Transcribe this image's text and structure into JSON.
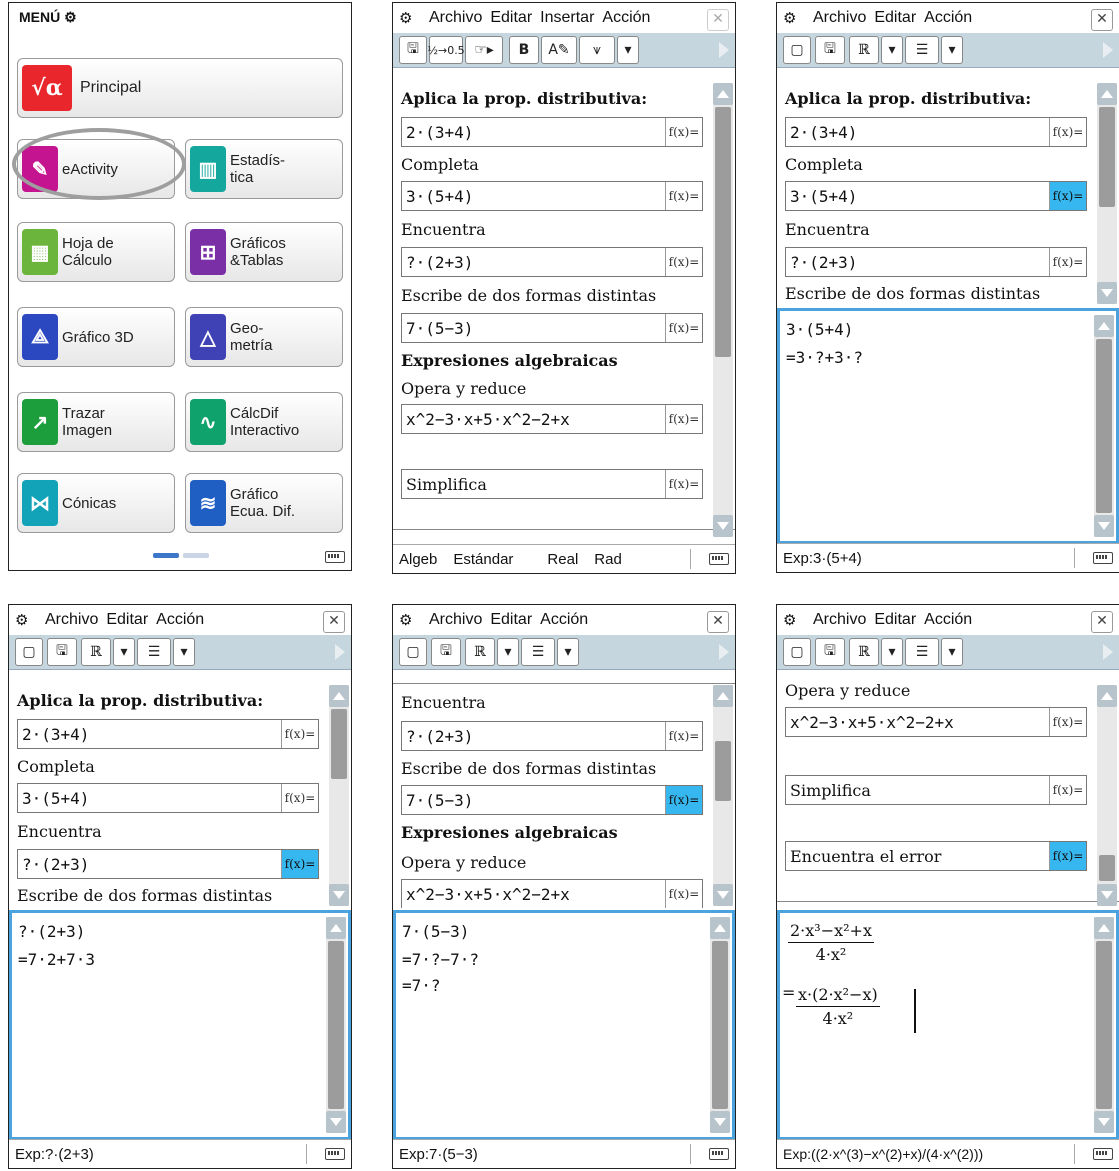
{
  "menu": {
    "header": "MENÚ",
    "items": [
      {
        "label": "Principal",
        "icon": "sqrt-alpha-icon",
        "color": "#e8262b",
        "glyph": "√α"
      },
      {
        "label": "eActivity",
        "icon": "eactivity-icon",
        "color": "#c4148f",
        "glyph": "✎"
      },
      {
        "label": "Estadís-\ntica",
        "icon": "statistics-icon",
        "color": "#14a79e",
        "glyph": "▥"
      },
      {
        "label": "Hoja de\nCálculo",
        "icon": "spreadsheet-icon",
        "color": "#6cb53c",
        "glyph": "▦"
      },
      {
        "label": "Gráficos\n&Tablas",
        "icon": "graph-table-icon",
        "color": "#7b2fa6",
        "glyph": "⊞"
      },
      {
        "label": "Gráfico 3D",
        "icon": "graph-3d-icon",
        "color": "#2c48c0",
        "glyph": "⟁"
      },
      {
        "label": "Geo-\nmetría",
        "icon": "geometry-icon",
        "color": "#3f42b4",
        "glyph": "△"
      },
      {
        "label": "Trazar\nImagen",
        "icon": "picture-plot-icon",
        "color": "#1b9e3b",
        "glyph": "↗"
      },
      {
        "label": "CálcDif\nInteractivo",
        "icon": "diffcalc-icon",
        "color": "#10a26c",
        "glyph": "∿"
      },
      {
        "label": "Cónicas",
        "icon": "conics-icon",
        "color": "#12a3b9",
        "glyph": "⋈"
      },
      {
        "label": "Gráfico\nEcua. Dif.",
        "icon": "diffeq-graph-icon",
        "color": "#1f5fc3",
        "glyph": "≋"
      }
    ]
  },
  "menubar_full": [
    "Archivo",
    "Editar",
    "Insertar",
    "Acción"
  ],
  "menubar_short": [
    "Archivo",
    "Editar",
    "Acción"
  ],
  "toolbar2": {
    "frac": "½→0.5",
    "hand": "☞▸",
    "bold": "B",
    "edit": "A✎",
    "graph": "⩛",
    "drop": "▾"
  },
  "toolbar3": {
    "new": "▢",
    "save": "🖫",
    "real": "ℝ",
    "drop": "▾",
    "list": "☰",
    "drop2": "▾"
  },
  "fx": "f(x)=",
  "ea": {
    "t1": "Aplica la prop. distributiva:",
    "e1": "2·(3+4)",
    "t2": "Completa",
    "e2": "3·(5+4)",
    "t3": "Encuentra",
    "e3": "?·(2+3)",
    "t4": "Escribe de dos formas distintas",
    "e4": "7·(5−3)",
    "t5": "Expresiones algebraicas",
    "t6": "Opera y reduce",
    "e6": "x^2−3·x+5·x^2−2+x",
    "e7": "Simplifica",
    "e8": "Encuentra el error"
  },
  "calc3": {
    "l1": "3·(5+4)",
    "l2": "=3·?+3·?"
  },
  "calc4": {
    "l1": "?·(2+3)",
    "l2": "=7·2+7·3"
  },
  "calc5": {
    "l1": "7·(5−3)",
    "l2": "=7·?−7·?",
    "l3": "=7·?"
  },
  "calc6": {
    "n1": "2·x³−x²+x",
    "d1": "4·x²",
    "eq": "=",
    "n2": "x·(2·x²−x)",
    "d2": "4·x²"
  },
  "status2": [
    "Algeb",
    "Estándar",
    "Real",
    "Rad"
  ],
  "status3": "Exp:3·(5+4)",
  "status4": "Exp:?·(2+3)",
  "status5": "Exp:7·(5−3)",
  "status6": "Exp:((2·x^(3)−x^(2)+x)/(4·x^(2)))"
}
